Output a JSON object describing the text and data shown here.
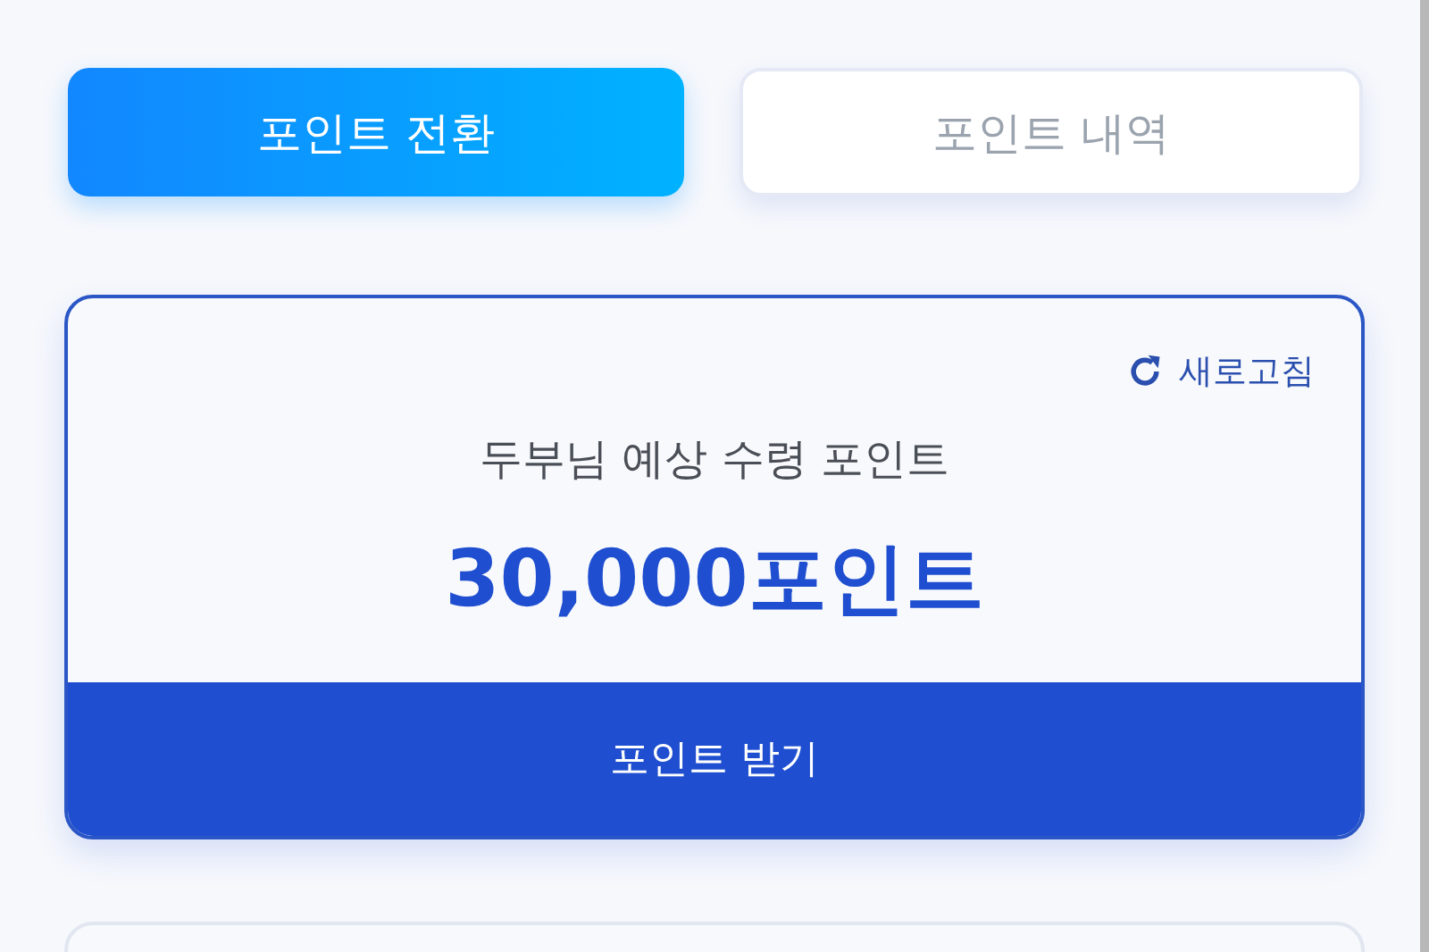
{
  "tabs": [
    {
      "label": "포인트 전환",
      "selected": true
    },
    {
      "label": "포인트 내역",
      "selected": false
    }
  ],
  "points_card": {
    "refresh": "새로고침",
    "label": "두부님 예상 수령 포인트",
    "amount": "30,000포인트",
    "button": "포인트 받기"
  }
}
